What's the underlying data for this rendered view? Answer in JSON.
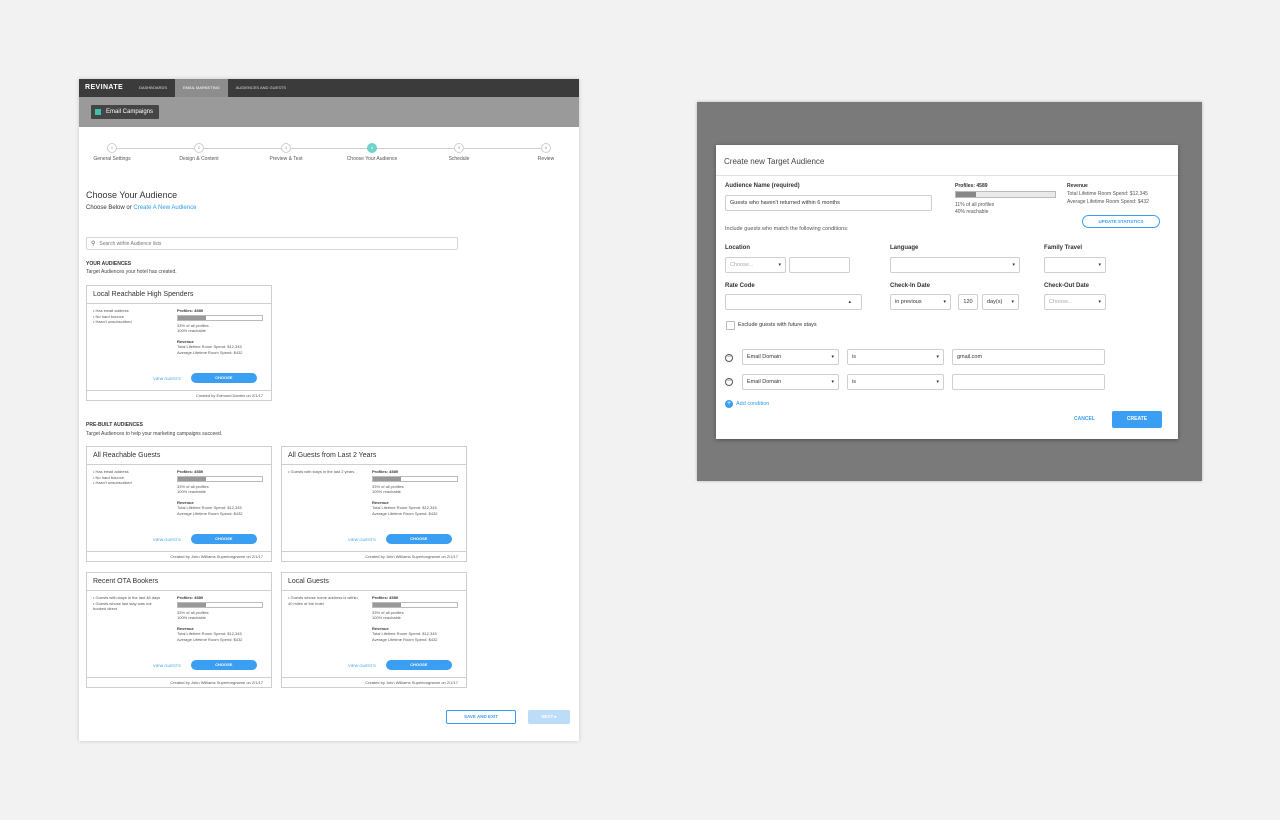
{
  "left": {
    "nav": {
      "logo": "REVINATE",
      "tabs": [
        "DASHBOARDS",
        "EMAIL MARKETING",
        "AUDIENCES AND GUESTS"
      ]
    },
    "subnav": {
      "button_label": "Email Campaigns"
    },
    "steps": [
      {
        "num": "1",
        "label": "General Settings"
      },
      {
        "num": "2",
        "label": "Design & Content"
      },
      {
        "num": "3",
        "label": "Preview & Test"
      },
      {
        "num": "4",
        "label": "Choose Your Audience"
      },
      {
        "num": "5",
        "label": "Schedule"
      },
      {
        "num": "6",
        "label": "Review"
      }
    ],
    "title": "Choose Your Audience",
    "subtitle_prefix": "Choose Below or ",
    "subtitle_link": "Create A New Audience",
    "search_placeholder": "Search within Audience lists",
    "your_audiences": {
      "heading": "YOUR AUDIENCES",
      "sub": "Target Audiences your hotel has created."
    },
    "prebuilt": {
      "heading": "PRE-BUILT AUDIENCES",
      "sub": "Target Audiences to help your marketing campaigns succeed."
    },
    "cards": [
      {
        "title": "Local Reachable High Spenders",
        "criteria": [
          "Has email address",
          "No hard bounce",
          "Hasn't unsubscribed"
        ],
        "profiles": "Profiles: 4589",
        "fill_fraction": 0.33,
        "pct": "33% of all profiles",
        "reach": "100% reachable",
        "revenue_label": "Revenue",
        "total": "Total Lifetime Room Spend: $12,345",
        "avg": "Average Lifetime Room Spend: $432",
        "view": "VIEW GUESTS",
        "choose": "CHOOSE",
        "footer": "Created by Edmund Dantes on 2/1/17"
      },
      {
        "title": "All Reachable Guests",
        "criteria": [
          "Has email address",
          "No hard bounce",
          "Hasn't unsubscribed"
        ],
        "profiles": "Profiles: 4589",
        "fill_fraction": 0.33,
        "pct": "33% of all profiles",
        "reach": "100% reachable",
        "revenue_label": "Revenue",
        "total": "Total Lifetime Room Spend: $12,345",
        "avg": "Average Lifetime Room Spend: $432",
        "view": "VIEW GUESTS",
        "choose": "CHOOSE",
        "footer": "Created by John Williams Supertongname on 2/1/17"
      },
      {
        "title": "All Guests from Last 2 Years",
        "criteria": [
          "Guests with stays in the last 2 years"
        ],
        "profiles": "Profiles: 4589",
        "fill_fraction": 0.33,
        "pct": "33% of all profiles",
        "reach": "100% reachable",
        "revenue_label": "Revenue",
        "total": "Total Lifetime Room Spend: $12,345",
        "avg": "Average Lifetime Room Spend: $432",
        "view": "VIEW GUESTS",
        "choose": "CHOOSE",
        "footer": "Created by John Williams Supertongname on 2/1/17"
      },
      {
        "title": "Recent OTA Bookers",
        "criteria": [
          "Guests with stays in the last 48 days",
          "Guests whose last stay was not booked direct"
        ],
        "profiles": "Profiles: 4589",
        "fill_fraction": 0.33,
        "pct": "33% of all profiles",
        "reach": "100% reachable",
        "revenue_label": "Revenue",
        "total": "Total Lifetime Room Spend: $12,345",
        "avg": "Average Lifetime Room Spend: $432",
        "view": "VIEW GUESTS",
        "choose": "CHOOSE",
        "footer": "Created by John Williams Supertongname on 2/1/17"
      },
      {
        "title": "Local Guests",
        "criteria": [
          "Guests whose home address is within 40 miles of the hotel"
        ],
        "profiles": "Profiles: 4589",
        "fill_fraction": 0.33,
        "pct": "33% of all profiles",
        "reach": "100% reachable",
        "revenue_label": "Revenue",
        "total": "Total Lifetime Room Spend: $12,345",
        "avg": "Average Lifetime Room Spend: $432",
        "view": "VIEW GUESTS",
        "choose": "CHOOSE",
        "footer": "Created by John Williams Supertongname on 2/1/17"
      }
    ],
    "save_exit": "SAVE AND EXIT",
    "next": "NEXT ▸"
  },
  "modal": {
    "title": "Create new Target Audience",
    "name_label": "Audience Name (required)",
    "name_value": "Guests who haven't returned within 6 months",
    "profiles": "Profiles: 4589",
    "fill_fraction": 0.2,
    "pct": "11% of all profiles",
    "reach": "40% reachable",
    "revenue_label": "Revenue",
    "total": "Total Lifetime Room Spend: $12,345",
    "avg": "Average Lifetime Room Spend: $432",
    "update_btn": "UPDATE STATISTICS",
    "include_text": "Include guests who match the following conditions:",
    "location_label": "Location",
    "location_placeholder": "Choose...",
    "language_label": "Language",
    "family_label": "Family Travel",
    "rate_label": "Rate Code",
    "checkin_label": "Check-In Date",
    "checkin_mode": "in previous",
    "checkin_num": "120",
    "checkin_unit": "day(s)",
    "checkout_label": "Check-Out Date",
    "checkout_placeholder": "Choose...",
    "exclude_label": "Exclude guests with future stays",
    "conditions": [
      {
        "field": "Email Domain",
        "op": "is",
        "value": "gmail.com"
      },
      {
        "field": "Email Domain",
        "op": "is",
        "value": ""
      }
    ],
    "add_condition": "Add condition",
    "cancel": "CANCEL",
    "create": "CREATE"
  },
  "colors": {
    "accent": "#3a9ef2",
    "teal": "#6fd3cc",
    "nav_dark": "#3b3b3b",
    "overlay_gray": "#7a7a7a"
  }
}
